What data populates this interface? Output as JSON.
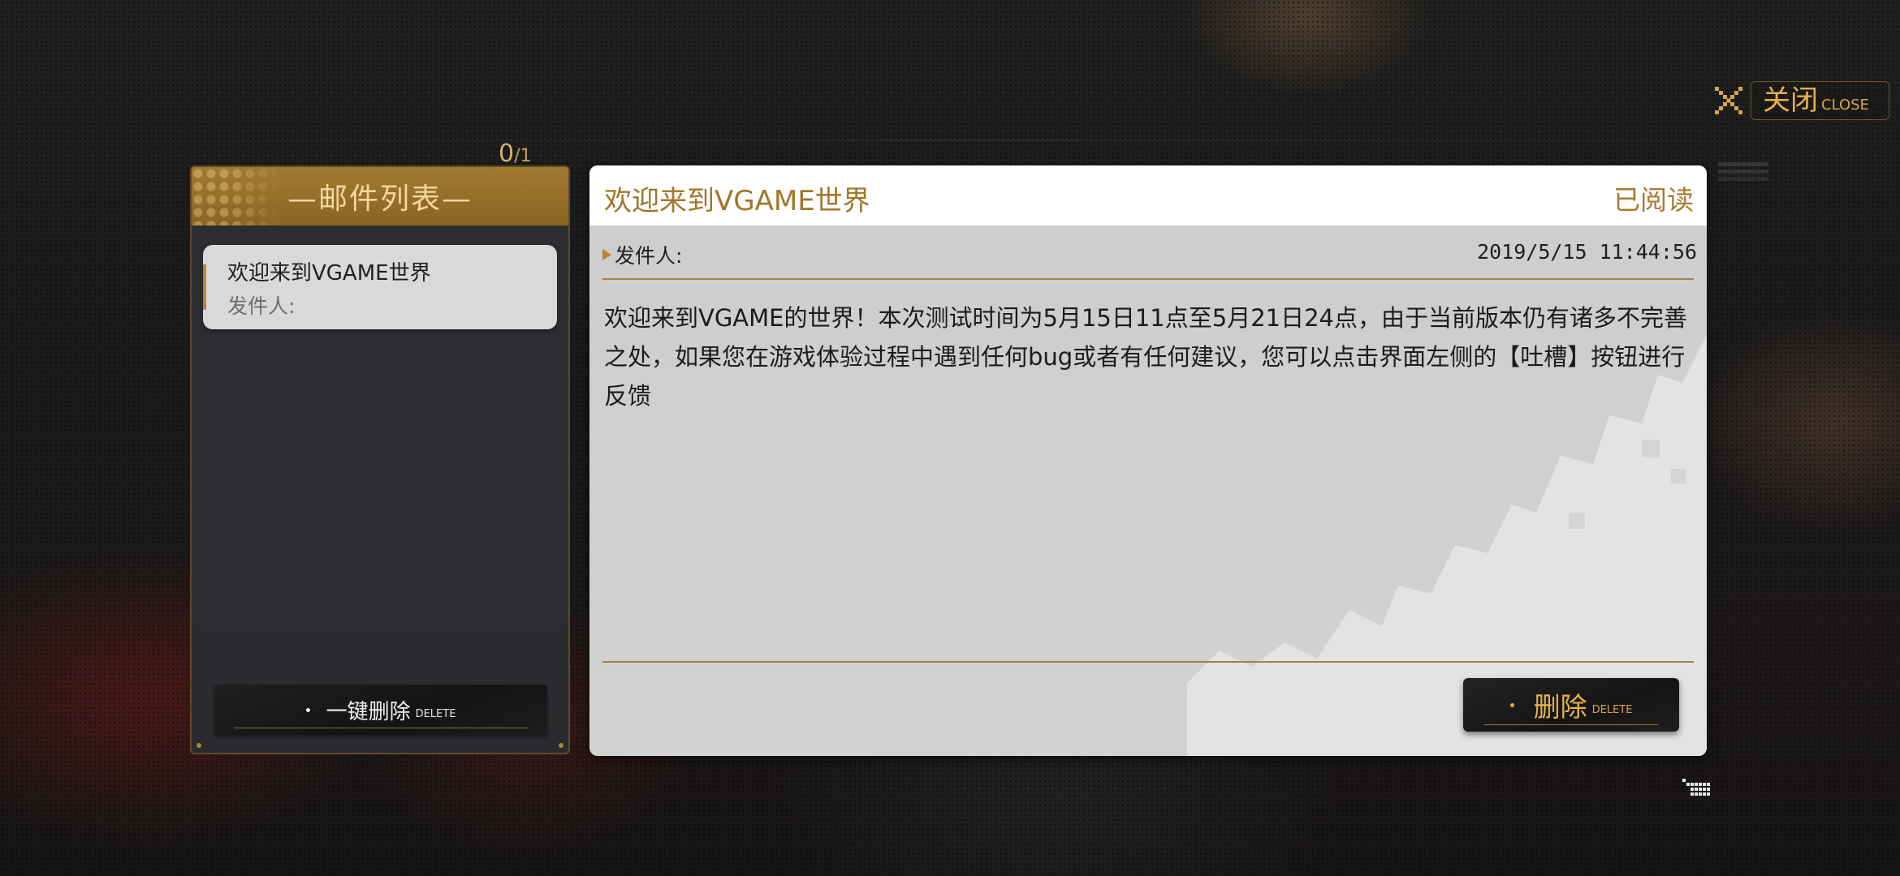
{
  "close_button": {
    "label_cn": "关闭",
    "label_en": "CLOSE"
  },
  "mail_counter": {
    "current": "0",
    "total": "/1"
  },
  "mail_list": {
    "title": "—邮件列表—",
    "items": [
      {
        "title": "欢迎来到VGAME世界",
        "sender": "发件人:"
      }
    ],
    "delete_all": {
      "label_cn": "一键删除",
      "label_en": "DELETE"
    }
  },
  "mail_detail": {
    "title": "欢迎来到VGAME世界",
    "status": "已阅读",
    "sender_label": "发件人:",
    "timestamp": "2019/5/15 11:44:56",
    "body": "欢迎来到VGAME的世界！本次测试时间为5月15日11点至5月21日24点，由于当前版本仍有诸多不完善之处，如果您在游戏体验过程中遇到任何bug或者有任何建议，您可以点击界面左侧的【吐槽】按钮进行反馈",
    "delete_button": {
      "label_cn": "删除",
      "label_en": "DELETE"
    }
  },
  "colors": {
    "accent_gold": "#e7b04a",
    "header_gold": "#a27a31",
    "panel_light": "#d0d0d0",
    "panel_dark": "#2c2e32"
  },
  "icons": [
    "close-x-icon",
    "sender-arrow-icon",
    "grid-icon",
    "stripes-icon"
  ]
}
